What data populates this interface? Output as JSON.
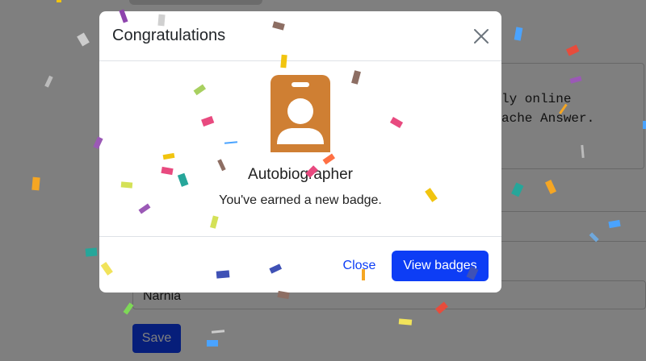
{
  "background": {
    "textarea_lines": [
      "ly online",
      "ache Answer."
    ],
    "location_value": "Narnia",
    "save_label": "Save"
  },
  "modal": {
    "title": "Congratulations",
    "badge": {
      "name": "Autobiographer",
      "message": "You've earned a new badge.",
      "icon": "id-badge-icon",
      "icon_color": "#cf7f33"
    },
    "close_label": "Close",
    "view_badges_label": "View badges"
  },
  "colors": {
    "primary": "#0d3df5",
    "overlay": "rgba(0,0,0,0.5)"
  }
}
